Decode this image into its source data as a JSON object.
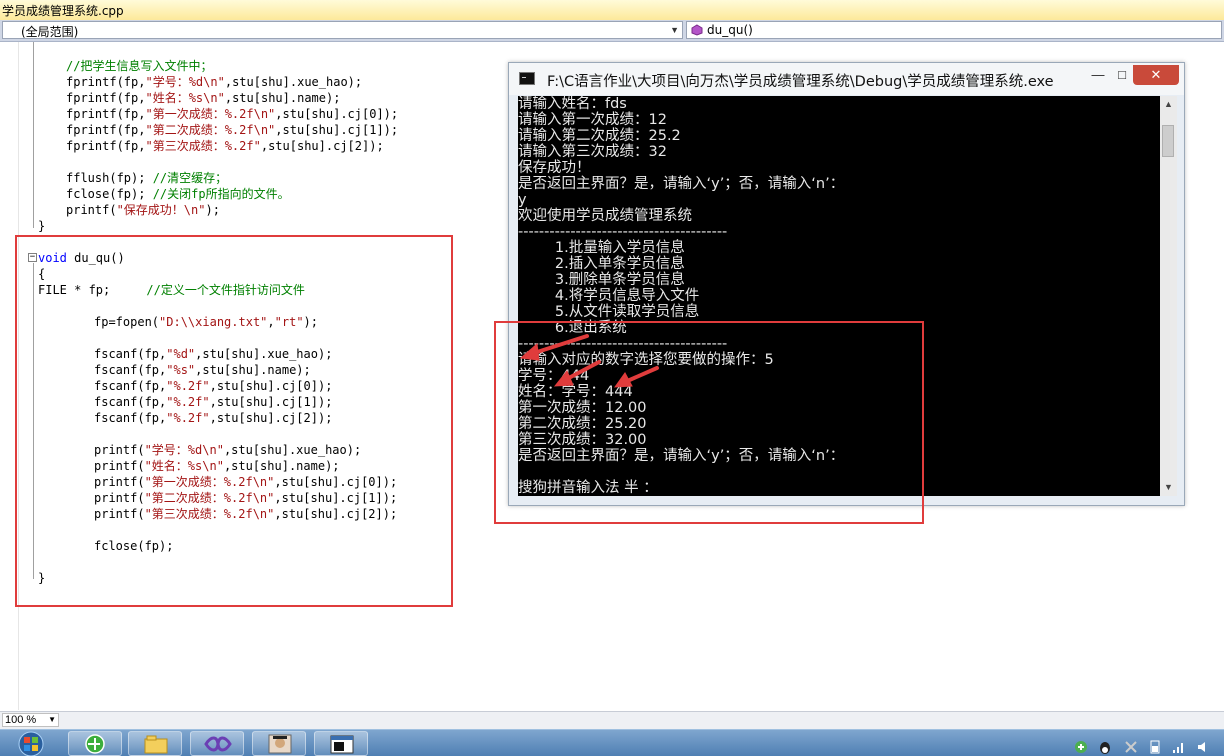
{
  "editor_tab": {
    "title": "学员成绩管理系统.cpp"
  },
  "navigation": {
    "scope": "(全局范围)",
    "function": "du_qu()"
  },
  "code": {
    "l1": "//把学生信息写入文件中；",
    "l2_a": "fprintf(fp,",
    "l2_s": "\"学号：%d\\n\"",
    "l2_b": ",stu[shu].xue_hao);",
    "l3_a": "fprintf(fp,",
    "l3_s": "\"姓名：%s\\n\"",
    "l3_b": ",stu[shu].name);",
    "l4_a": "fprintf(fp,",
    "l4_s": "\"第一次成绩：%.2f\\n\"",
    "l4_b": ",stu[shu].cj[0]);",
    "l5_a": "fprintf(fp,",
    "l5_s": "\"第二次成绩：%.2f\\n\"",
    "l5_b": ",stu[shu].cj[1]);",
    "l6_a": "fprintf(fp,",
    "l6_s": "\"第三次成绩：%.2f\"",
    "l6_b": ",stu[shu].cj[2]);",
    "l7_a": "fflush(fp); ",
    "l7_c": "//清空缓存；",
    "l8_a": "fclose(fp); ",
    "l8_c": "//关闭fp所指向的文件。",
    "l9_a": "printf(",
    "l9_s": "\"保存成功！\\n\"",
    "l9_b": ");",
    "l10": "}",
    "f1_kw": "void",
    "f1_b": " du_qu()",
    "f2": "{",
    "f3_a": "FILE * fp;     ",
    "f3_c": "//定义一个文件指针访问文件",
    "f4_a": "fp=fopen(",
    "f4_s1": "\"D:\\\\xiang.txt\"",
    "f4_m": ",",
    "f4_s2": "\"rt\"",
    "f4_b": ");",
    "f5_a": "fscanf(fp,",
    "f5_s": "\"%d\"",
    "f5_b": ",stu[shu].xue_hao);",
    "f6_a": "fscanf(fp,",
    "f6_s": "\"%s\"",
    "f6_b": ",stu[shu].name);",
    "f7_a": "fscanf(fp,",
    "f7_s": "\"%.2f\"",
    "f7_b": ",stu[shu].cj[0]);",
    "f8_a": "fscanf(fp,",
    "f8_s": "\"%.2f\"",
    "f8_b": ",stu[shu].cj[1]);",
    "f9_a": "fscanf(fp,",
    "f9_s": "\"%.2f\"",
    "f9_b": ",stu[shu].cj[2]);",
    "f10_a": "printf(",
    "f10_s": "\"学号：%d\\n\"",
    "f10_b": ",stu[shu].xue_hao);",
    "f11_a": "printf(",
    "f11_s": "\"姓名：%s\\n\"",
    "f11_b": ",stu[shu].name);",
    "f12_a": "printf(",
    "f12_s": "\"第一次成绩：%.2f\\n\"",
    "f12_b": ",stu[shu].cj[0]);",
    "f13_a": "printf(",
    "f13_s": "\"第二次成绩：%.2f\\n\"",
    "f13_b": ",stu[shu].cj[1]);",
    "f14_a": "printf(",
    "f14_s": "\"第三次成绩：%.2f\\n\"",
    "f14_b": ",stu[shu].cj[2]);",
    "f15": "fclose(fp);",
    "f16": "}"
  },
  "console": {
    "title": "F:\\C语言作业\\大项目\\向万杰\\学员成绩管理系统\\Debug\\学员成绩管理系统.exe",
    "min_glyph": "—",
    "max_glyph": "□",
    "close_glyph": "✕",
    "lines": {
      "c1": "请输入姓名：fds",
      "c2": "请输入第一次成绩：12",
      "c3": "请输入第二次成绩：25.2",
      "c4": "请输入第三次成绩：32",
      "c5": "保存成功！",
      "c6": "是否返回主界面？是，请输入‘y’；否，请输入‘n’：",
      "c7": "y",
      "c8": "欢迎使用学员成绩管理系统",
      "c9": "----------------------------------------",
      "c10": "        1.批量输入学员信息",
      "c11": "        2.插入单条学员信息",
      "c12": "        3.删除单条学员信息",
      "c13": "        4.将学员信息导入文件",
      "c14": "        5.从文件读取学员信息",
      "c15": "        6.退出系统",
      "c16": "----------------------------------------",
      "c17": "请输入对应的数字选择您要做的操作：5",
      "c18": "学号：444",
      "c19": "姓名：学号：444",
      "c20": "第一次成绩：12.00",
      "c21": "第二次成绩：25.20",
      "c22": "第三次成绩：32.00",
      "c23": "是否返回主界面？是，请输入‘y’；否，请输入‘n’：",
      "c24": "搜狗拼音输入法 半 ："
    }
  },
  "zoom": {
    "value": "100 %"
  },
  "colors": {
    "annotation_red": "#e03c3c",
    "keyword": "#0000ff",
    "string": "#a31515",
    "comment": "#008000"
  }
}
